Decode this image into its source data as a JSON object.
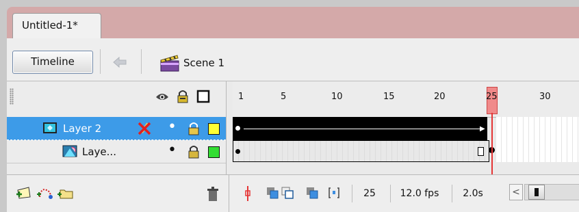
{
  "document_tab": {
    "title": "Untitled-1*"
  },
  "toolbar": {
    "timeline_button": "Timeline",
    "scene_label": "Scene 1",
    "back_icon": "arrow-left-icon",
    "scene_icon": "clapperboard-icon"
  },
  "layer_header": {
    "icons": [
      "eye-icon",
      "lock-icon",
      "outline-square-icon"
    ]
  },
  "layers": [
    {
      "name": "Layer 2",
      "icon": "layer-icon",
      "selected": true,
      "pencil_icon": "pencil-crossed-icon",
      "color": "#ffff33"
    },
    {
      "name": "Laye...",
      "icon": "mask-layer-icon",
      "selected": false,
      "color": "#33dd33"
    }
  ],
  "ruler": {
    "labels": [
      "1",
      "5",
      "10",
      "15",
      "20",
      "25",
      "30"
    ],
    "current_frame_label": "25"
  },
  "status": {
    "current_frame": "25",
    "frame_rate": "12.0 fps",
    "elapsed_time": "2.0s"
  },
  "bottom_icons": [
    "new-layer-icon",
    "motion-guide-icon",
    "new-folder-icon",
    "trash-icon",
    "center-frame-icon",
    "onion-skin-icon",
    "onion-skin-outlines-icon",
    "edit-multiple-frames-icon",
    "modify-markers-icon"
  ],
  "colors": {
    "selection": "#3d9be8",
    "playhead": "#e53535",
    "background": "#d4a9a9"
  }
}
